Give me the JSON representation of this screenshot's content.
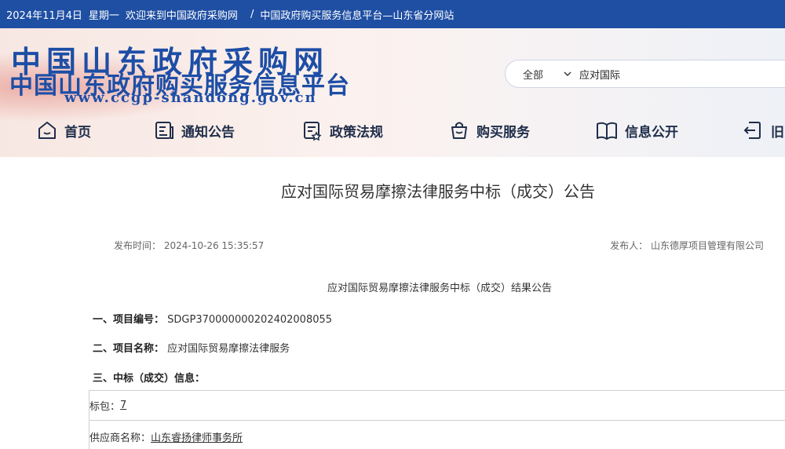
{
  "topbar": {
    "date": "2024年11月4日",
    "weekday": "星期一",
    "welcome": "欢迎来到中国政府采购网",
    "separator": "/",
    "platform": "中国政府购买服务信息平台—山东省分网站"
  },
  "logo": {
    "line1": "中国山东政府采购网",
    "line2": "中国山东政府购买服务信息平台",
    "url": "www.ccgp-shandong.gov.cn"
  },
  "search": {
    "scope": "全部",
    "query": "应对国际"
  },
  "nav": {
    "items": [
      {
        "label": "首页",
        "icon": "home-icon"
      },
      {
        "label": "通知公告",
        "icon": "notice-icon"
      },
      {
        "label": "政策法规",
        "icon": "policy-icon"
      },
      {
        "label": "购买服务",
        "icon": "basket-icon"
      },
      {
        "label": "信息公开",
        "icon": "book-icon"
      },
      {
        "label": "旧",
        "icon": "exit-icon"
      }
    ]
  },
  "article": {
    "title": "应对国际贸易摩擦法律服务中标（成交）公告",
    "publish_time_label": "发布时间：",
    "publish_time": "2024-10-26 15:35:57",
    "publisher_label": "发布人：",
    "publisher": "山东德厚项目管理有限公司",
    "subtitle": "应对国际贸易摩擦法律服务中标（成交）结果公告",
    "project_no_label": "一、项目编号：",
    "project_no": "SDGP370000000202402008055",
    "project_name_label": "二、项目名称：",
    "project_name": "应对国际贸易摩擦法律服务",
    "award_label": "三、中标（成交）信息：",
    "lot_label": "标包：",
    "lot_value": "7",
    "supplier_label": "供应商名称：",
    "supplier_value": "山东睿扬律师事务所"
  },
  "colors": {
    "topbar": "#1f4fa3",
    "logo": "#1d4ea6"
  }
}
